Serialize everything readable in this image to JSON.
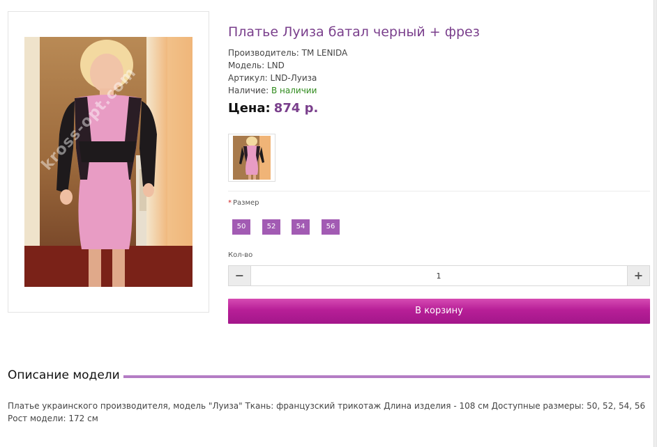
{
  "product": {
    "title": "Платье Луиза батал черный + фрез",
    "watermark": "kross-opt.com",
    "manufacturer_label": "Производитель:",
    "manufacturer_value": "TM LENIDA",
    "model_label": "Модель:",
    "model_value": "LND",
    "sku_label": "Артикул:",
    "sku_value": "LND-Луиза",
    "availability_label": "Наличие:",
    "availability_value": "В наличии",
    "price_label": "Цена:",
    "price_value": "874 р."
  },
  "options": {
    "size_required_mark": "*",
    "size_label": "Размер",
    "sizes": [
      "50",
      "52",
      "54",
      "56"
    ],
    "quantity_label": "Кол-во",
    "quantity_value": "1",
    "minus_symbol": "−",
    "plus_symbol": "+"
  },
  "cart": {
    "button_label": "В корзину"
  },
  "description": {
    "heading": "Описание модели",
    "text": "Платье украинского производителя, модель \"Луиза\" Ткань: французский трикотаж Длина изделия - 108 см Доступные размеры: 50, 52, 54, 56 Рост модели: 172 см"
  },
  "colors": {
    "title": "#7a3f8c",
    "price": "#7a3f8c",
    "in_stock": "#2f8a1c",
    "size_button": "#a25bb3",
    "cart_button": "#b71f97",
    "section_rule": "#b47cc4"
  },
  "icons": {
    "minus": "minus-icon",
    "plus": "plus-icon"
  }
}
